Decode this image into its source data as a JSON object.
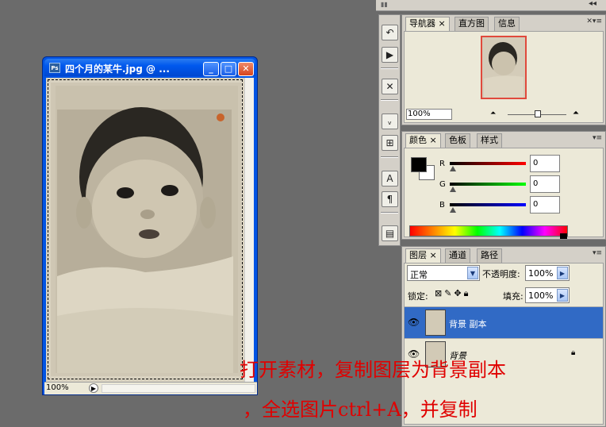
{
  "document_window": {
    "title": "四个月的某牛.jpg @ ...",
    "zoom": "100%",
    "buttons": {
      "minimize": "_",
      "maximize": "□",
      "close": "✕"
    }
  },
  "tool_strip": {
    "icons": [
      "history-icon",
      "actions-icon",
      "tool-presets-icon",
      "brushes-icon",
      "clone-source-icon",
      "character-icon",
      "paragraph-icon",
      "layer-comps-icon"
    ]
  },
  "navigator_panel": {
    "tabs": [
      "导航器",
      "直方图",
      "信息"
    ],
    "active_tab": "导航器",
    "zoom_value": "100%"
  },
  "color_panel": {
    "tabs": [
      "颜色",
      "色板",
      "样式"
    ],
    "active_tab": "颜色",
    "channels": [
      {
        "label": "R",
        "value": "0",
        "color": "#c00000"
      },
      {
        "label": "G",
        "value": "0",
        "color": "#00a000"
      },
      {
        "label": "B",
        "value": "0",
        "color": "#0000c0"
      }
    ],
    "foreground_color": "#000000",
    "background_color": "#ffffff"
  },
  "layers_panel": {
    "tabs": [
      "图层",
      "通道",
      "路径"
    ],
    "active_tab": "图层",
    "blend_mode": "正常",
    "opacity_label": "不透明度:",
    "opacity_value": "100%",
    "lock_label": "锁定:",
    "fill_label": "填充:",
    "fill_value": "100%",
    "layers": [
      {
        "name": "背景 副本",
        "selected": true
      },
      {
        "name": "背景",
        "selected": false,
        "locked": true
      }
    ]
  },
  "annotations": {
    "line1": "打开素材，复制图层为背景副本",
    "line2": "，全选图片ctrl+A，并复制"
  },
  "colors": {
    "selection_blue": "#316ac5",
    "annotation_red": "#e00000",
    "workspace_gray": "#6b6b6b"
  }
}
